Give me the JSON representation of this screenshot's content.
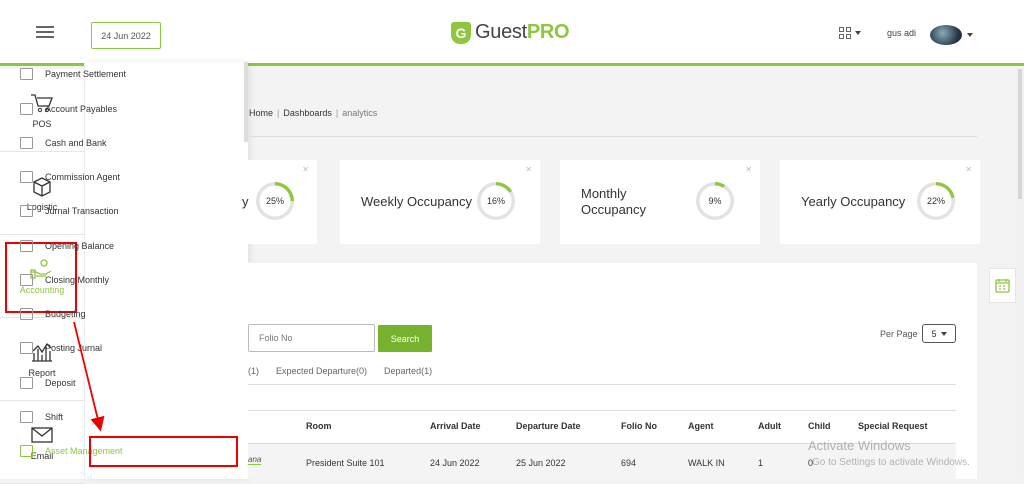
{
  "header": {
    "date": "24 Jun 2022",
    "logo_prefix": "Guest",
    "logo_suffix": "PRO",
    "username": "gus adi"
  },
  "side_nav": [
    {
      "label": "POS",
      "icon": "cart-icon"
    },
    {
      "label": "Logistic",
      "icon": "box-icon"
    },
    {
      "label": "Accounting",
      "icon": "money-hand-icon"
    },
    {
      "label": "Report",
      "icon": "chart-icon"
    },
    {
      "label": "Email",
      "icon": "mail-icon"
    }
  ],
  "submenu": [
    "Payment Settlement",
    "Account Payables",
    "Cash and Bank",
    "Commission Agent",
    "Jurnal Transaction",
    "Opening Balance",
    "Closing Monthly",
    "Budgeting",
    "Posting Jurnal",
    "Deposit",
    "Shift",
    "Asset Management"
  ],
  "breadcrumb": {
    "home": "Home",
    "dashboards": "Dashboards",
    "current": "analytics"
  },
  "cards": [
    {
      "title": "y",
      "percent": "25%",
      "value": 25
    },
    {
      "title": "Weekly Occupancy",
      "percent": "16%",
      "value": 16
    },
    {
      "title": "Monthly Occupancy",
      "percent": "9%",
      "value": 9
    },
    {
      "title": "Yearly Occupancy",
      "percent": "22%",
      "value": 22
    }
  ],
  "filters": {
    "folio_placeholder": "Folio No",
    "search_label": "Search",
    "per_page_label": "Per Page",
    "per_page_value": "5"
  },
  "tabs": [
    "(1)",
    "Expected Departure(0)",
    "Departed(1)"
  ],
  "table": {
    "headers": [
      "Room",
      "Arrival Date",
      "Departure Date",
      "Folio No",
      "Agent",
      "Adult",
      "Child",
      "Special Request"
    ],
    "row": {
      "guest_fragment": "ana",
      "cells": [
        "President Suite 101",
        "24 Jun 2022",
        "25 Jun 2022",
        "694",
        "WALK IN",
        "1",
        "0",
        ""
      ]
    }
  },
  "watermark": {
    "line1": "Activate Windows",
    "line2": "Go to Settings to activate Windows."
  },
  "colors": {
    "accent": "#8dc63f",
    "annotation": "#e00000"
  }
}
